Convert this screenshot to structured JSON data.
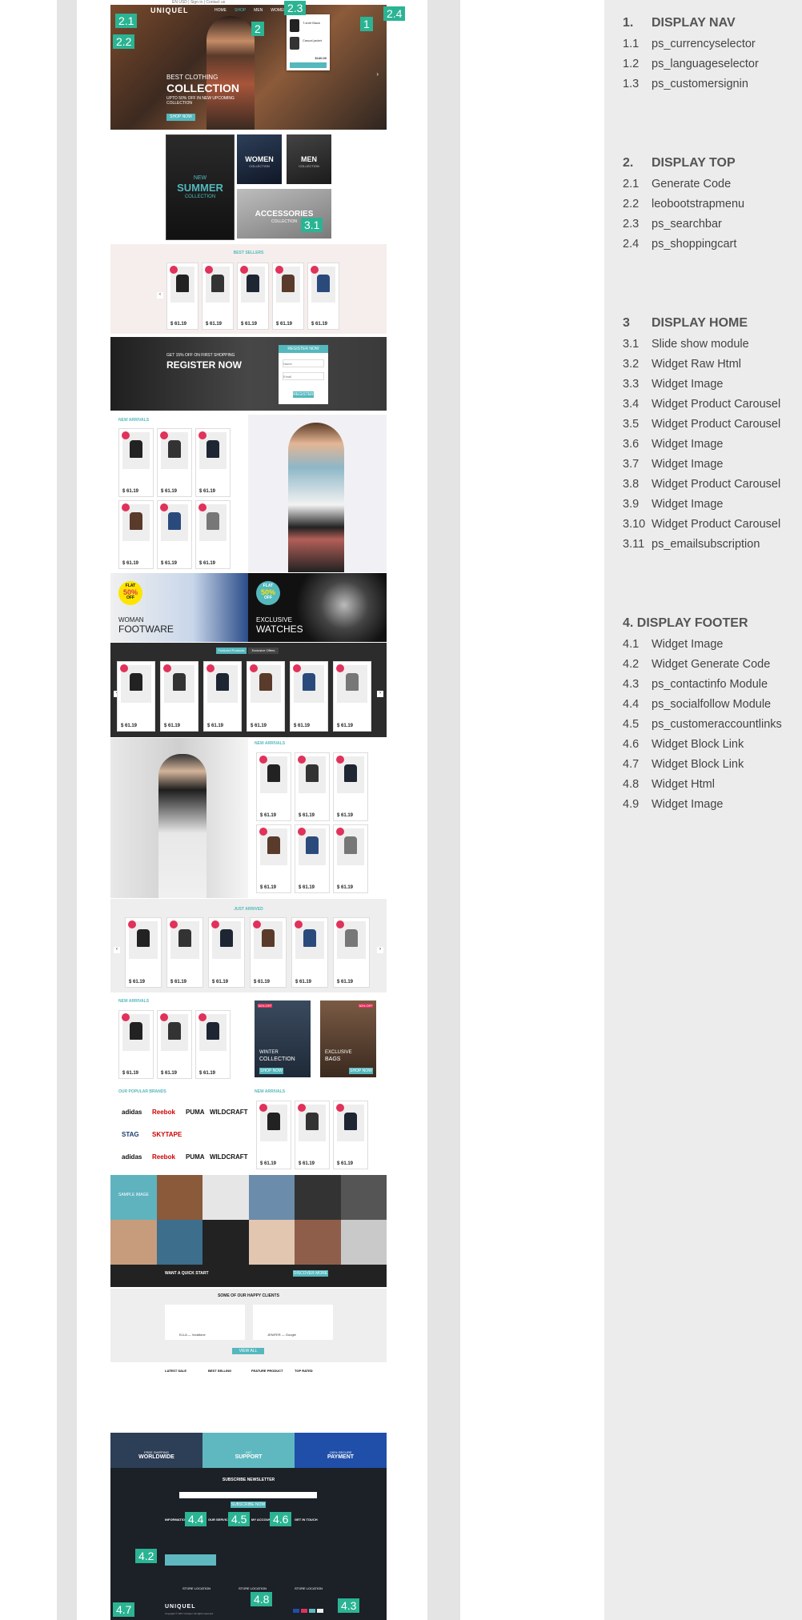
{
  "mockup": {
    "top_links": "EN USD | Sign in | Contact us",
    "header": {
      "logo": "UNIQUEL",
      "menu": [
        "HOME",
        "SHOP",
        "MEN",
        "WOMEN"
      ],
      "cart_items": [
        "T-shirt Black",
        "Casual jacket"
      ],
      "cart_total": "$140.00"
    },
    "hero": {
      "kicker": "BEST CLOTHING",
      "title": "COLLECTION",
      "subtitle": "UPTO 50% OFF IN NEW UPCOMING COLLECTION",
      "button": "SHOP NOW"
    },
    "categories": {
      "summer_top": "NEW",
      "summer_title": "SUMMER",
      "summer_sub": "COLLECTION",
      "women": "WOMEN",
      "women_sub": "COLLECTION",
      "men": "MEN",
      "men_sub": "COLLECTION",
      "accessories": "ACCESSORIES",
      "accessories_sub": "COLLECTION"
    },
    "best_sellers": "BEST SELLERS",
    "register": {
      "kicker": "GET 15% OFF ON FIRST SHOPPING",
      "title": "REGISTER NOW",
      "form_title": "REGISTER NOW",
      "name_placeholder": "Name",
      "email_placeholder": "Email",
      "button": "REGISTER"
    },
    "new_arrivals": "NEW ARRIVALS",
    "price": "$ 61.19",
    "footware": {
      "flat": "FLAT",
      "pct": "50%",
      "off": "OFF",
      "line1": "WOMAN",
      "line2": "FOOTWARE"
    },
    "watches": {
      "flat": "FLAT",
      "pct": "50%",
      "off": "OFF",
      "line1": "EXCLUSIVE",
      "line2": "WATCHES"
    },
    "tabs": [
      "Featured Products",
      "Exclusive Offers"
    ],
    "just_arrived": "JUST ARRIVED",
    "winter": {
      "pct": "50% OFF",
      "line1": "WINTER",
      "line2": "COLLECTION",
      "button": "SHOP NOW"
    },
    "bags": {
      "pct": "50% OFF",
      "line1": "EXCLUSIVE",
      "line2": "BAGS",
      "button": "SHOP NOW"
    },
    "brands_title": "OUR POPULAR BRANDS",
    "brands": [
      "adidas",
      "Reebok",
      "PUMA",
      "WILDCRAFT",
      "STAG",
      "SKYTAPE",
      "adidas",
      "Reebok",
      "PUMA",
      "WILDCRAFT"
    ],
    "sample_text": "SAMPLE IMAGE",
    "quick_start": "WANT A QUICK START",
    "quick_button": "DISCOVER MORE",
    "clients_title": "SOME OF OUR HAPPY CLIENTS",
    "client_names": [
      "ELLA — Vodafone",
      "JENIFER — Google"
    ],
    "view_all": "VIEW ALL",
    "footer_lists": [
      "LATEST SALE",
      "BEST SELLING",
      "FEATURE PRODUCT",
      "TOP RATED"
    ],
    "features": [
      {
        "top": "FREE SHIPPING",
        "main": "WORLDWIDE"
      },
      {
        "top": "24/7",
        "main": "SUPPORT"
      },
      {
        "top": "100% SECURE",
        "main": "PAYMENT"
      }
    ],
    "newsletter": "SUBSCRIBE NEWSLETTER",
    "subscribe_button": "SUBSCRIBE NOW",
    "footer_cols": [
      "INFORMATION",
      "OUR SERVICES",
      "MY ACCOUNT",
      "GET IN TOUCH"
    ],
    "store_location": "STORE LOCATION",
    "footer_logo": "UNIQUEL",
    "copyright": "Copyright © 2017 Uniquel. All rights reserved."
  },
  "badges": [
    "2.1",
    "2.2",
    "2.3",
    "2.4",
    "2",
    "1",
    "3.1",
    "4.4",
    "4.5",
    "4.6",
    "4.2",
    "4.7",
    "4.8",
    "4.3"
  ],
  "legend": {
    "g1": {
      "num": "1.",
      "title": "DISPLAY NAV",
      "items": [
        [
          "1.1",
          "ps_currencyselector"
        ],
        [
          "1.2",
          "ps_languageselector"
        ],
        [
          "1.3",
          "ps_customersignin"
        ]
      ]
    },
    "g2": {
      "num": "2.",
      "title": "DISPLAY TOP",
      "items": [
        [
          "2.1",
          "Generate Code"
        ],
        [
          "2.2",
          "leobootstrapmenu"
        ],
        [
          "2.3",
          "ps_searchbar"
        ],
        [
          "2.4",
          "ps_shoppingcart"
        ]
      ]
    },
    "g3": {
      "num": "3",
      "title": "DISPLAY HOME",
      "items": [
        [
          "3.1",
          "Slide show module"
        ],
        [
          "3.2",
          "Widget Raw Html"
        ],
        [
          "3.3",
          "Widget Image"
        ],
        [
          "3.4",
          "Widget Product Carousel"
        ],
        [
          "3.5",
          "Widget Product Carousel"
        ],
        [
          "3.6",
          "Widget Image"
        ],
        [
          "3.7",
          "Widget Image"
        ],
        [
          "3.8",
          "Widget Product Carousel"
        ],
        [
          "3.9",
          "Widget Image"
        ],
        [
          "3.10",
          "Widget Product Carousel"
        ],
        [
          "3.11",
          "ps_emailsubscription"
        ]
      ]
    },
    "g4": {
      "num": "4.",
      "title": "DISPLAY FOOTER",
      "items": [
        [
          "4.1",
          "Widget Image"
        ],
        [
          "4.2",
          "Widget Generate Code"
        ],
        [
          "4.3",
          "ps_contactinfo Module"
        ],
        [
          "4.4",
          "ps_socialfollow Module"
        ],
        [
          "4.5",
          "ps_customeraccountlinks"
        ],
        [
          "4.6",
          "Widget Block Link"
        ],
        [
          "4.7",
          "Widget Block Link"
        ],
        [
          "4.8",
          "Widget Html"
        ],
        [
          "4.9",
          "Widget Image"
        ]
      ]
    }
  }
}
